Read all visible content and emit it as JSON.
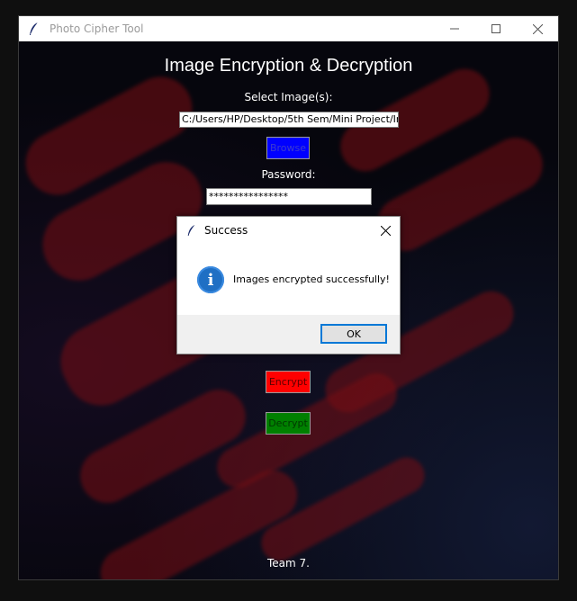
{
  "window": {
    "title": "Photo Cipher Tool",
    "controls": [
      "minimize-icon",
      "maximize-icon",
      "close-icon"
    ]
  },
  "app": {
    "heading": "Image Encryption & Decryption",
    "select_label": "Select Image(s):",
    "path_value": "C:/Users/HP/Desktop/5th Sem/Mini Project/Ir",
    "browse_label": "Browse",
    "password_label": "Password:",
    "password_value": "****************",
    "encrypt_label": "Encrypt",
    "decrypt_label": "Decrypt",
    "footer": "Team 7."
  },
  "dialog": {
    "title": "Success",
    "icon": "info-icon",
    "icon_glyph": "i",
    "message": "Images encrypted successfully!",
    "ok_label": "OK"
  },
  "colors": {
    "browse_bg": "#0000ff",
    "encrypt_bg": "#ff0000",
    "decrypt_bg": "#008000",
    "info_blue": "#1f6fc4",
    "ok_border": "#0078d7"
  }
}
